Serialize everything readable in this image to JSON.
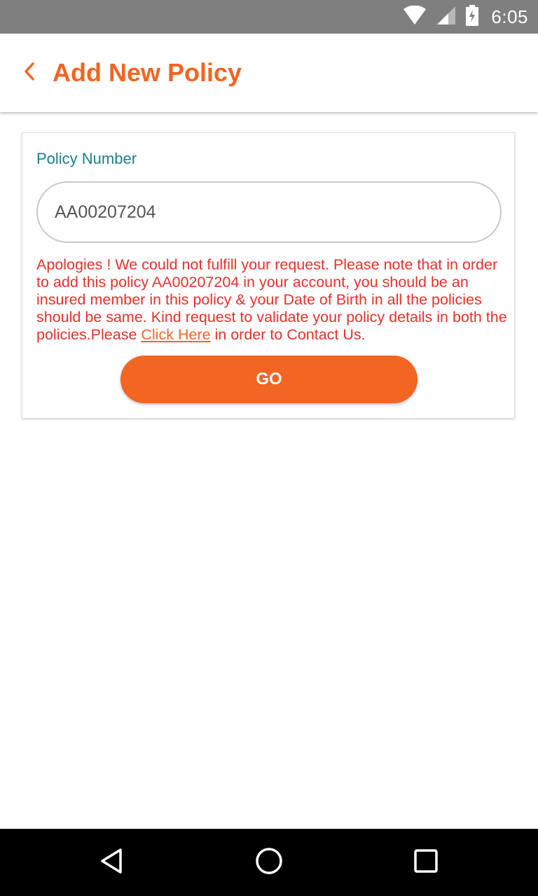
{
  "status_bar": {
    "time": "6:05",
    "icons": [
      "wifi-icon",
      "cell-signal-icon",
      "battery-charging-icon"
    ]
  },
  "header": {
    "title": "Add New Policy",
    "back_icon": "chevron-left-icon"
  },
  "form": {
    "policy_label": "Policy Number",
    "policy_value": "AA00207204",
    "error_text_before_link": "Apologies ! We could not fulfill your request. Please note that in order to add this policy AA00207204 in your account, you should be an insured member in this policy & your Date of Birth in all the policies should be same. Kind request to validate your policy details in both the policies.Please ",
    "error_link_text": "Click Here",
    "error_text_after_link": " in order to Contact Us.",
    "go_label": "GO"
  },
  "nav_bar": {
    "icons": [
      "back-triangle-icon",
      "home-circle-icon",
      "recents-square-icon"
    ]
  },
  "colors": {
    "accent": "#f26522",
    "label": "#1a7f8e",
    "error": "#e8302b",
    "status_bar": "#7f7f7f"
  }
}
